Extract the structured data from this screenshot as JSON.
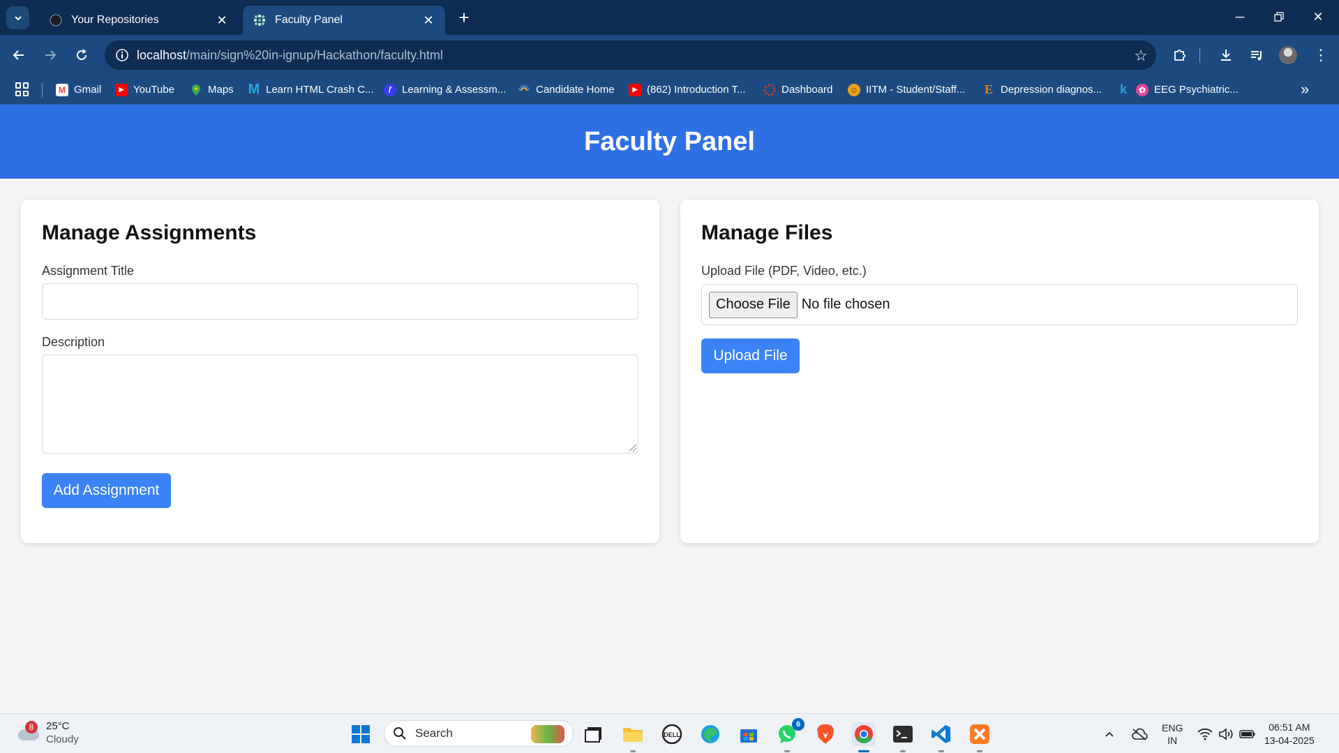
{
  "browser": {
    "tabs": [
      {
        "title": "Your Repositories",
        "active": false,
        "icon": "github-icon"
      },
      {
        "title": "Faculty Panel",
        "active": true,
        "icon": "dots-icon"
      }
    ],
    "url_host": "localhost",
    "url_path": "/main/sign%20in-ignup/Hackathon/faculty.html",
    "bookmarks": [
      {
        "label": "Gmail",
        "icon": "gmail-icon",
        "color": "#ea4335"
      },
      {
        "label": "YouTube",
        "icon": "youtube-icon",
        "color": "#ff0000"
      },
      {
        "label": "Maps",
        "icon": "maps-icon",
        "color": "#34a853"
      },
      {
        "label": "Learn HTML Crash C...",
        "icon": "m-icon",
        "color": "#2aa5e0"
      },
      {
        "label": "Learning & Assessm...",
        "icon": "learning-icon",
        "color": "#3b3bf0"
      },
      {
        "label": "Candidate Home",
        "icon": "candidate-icon",
        "color": "#3b82c4"
      },
      {
        "label": "(862) Introduction T...",
        "icon": "youtube-icon",
        "color": "#ff0000"
      },
      {
        "label": "Dashboard",
        "icon": "dashboard-icon",
        "color": "#c0392b"
      },
      {
        "label": "IITM - Student/Staff...",
        "icon": "iitm-icon",
        "color": "#e6a017"
      },
      {
        "label": "Depression diagnos...",
        "icon": "e-icon",
        "color": "#e67e22"
      },
      {
        "label": "EEG Psychiatric...",
        "icon": "brain-icon",
        "color": "#e84393"
      }
    ],
    "bookmark_k": "k"
  },
  "page": {
    "header_title": "Faculty Panel",
    "assignments": {
      "heading": "Manage Assignments",
      "title_label": "Assignment Title",
      "title_value": "",
      "description_label": "Description",
      "description_value": "",
      "add_button": "Add Assignment"
    },
    "files": {
      "heading": "Manage Files",
      "upload_label": "Upload File (PDF, Video, etc.)",
      "choose_button": "Choose File",
      "file_status": "No file chosen",
      "upload_button": "Upload File"
    }
  },
  "taskbar": {
    "weather_temp": "25°C",
    "weather_desc": "Cloudy",
    "weather_badge": "8",
    "search_placeholder": "Search",
    "whatsapp_badge": "6",
    "lang_top": "ENG",
    "lang_bottom": "IN",
    "time": "06:51 AM",
    "date": "13-04-2025"
  },
  "colors": {
    "header_blue": "#2f6fe4",
    "button_blue": "#3b82f6",
    "chrome_dark": "#0f2c52",
    "chrome_tab": "#1c4a80"
  }
}
